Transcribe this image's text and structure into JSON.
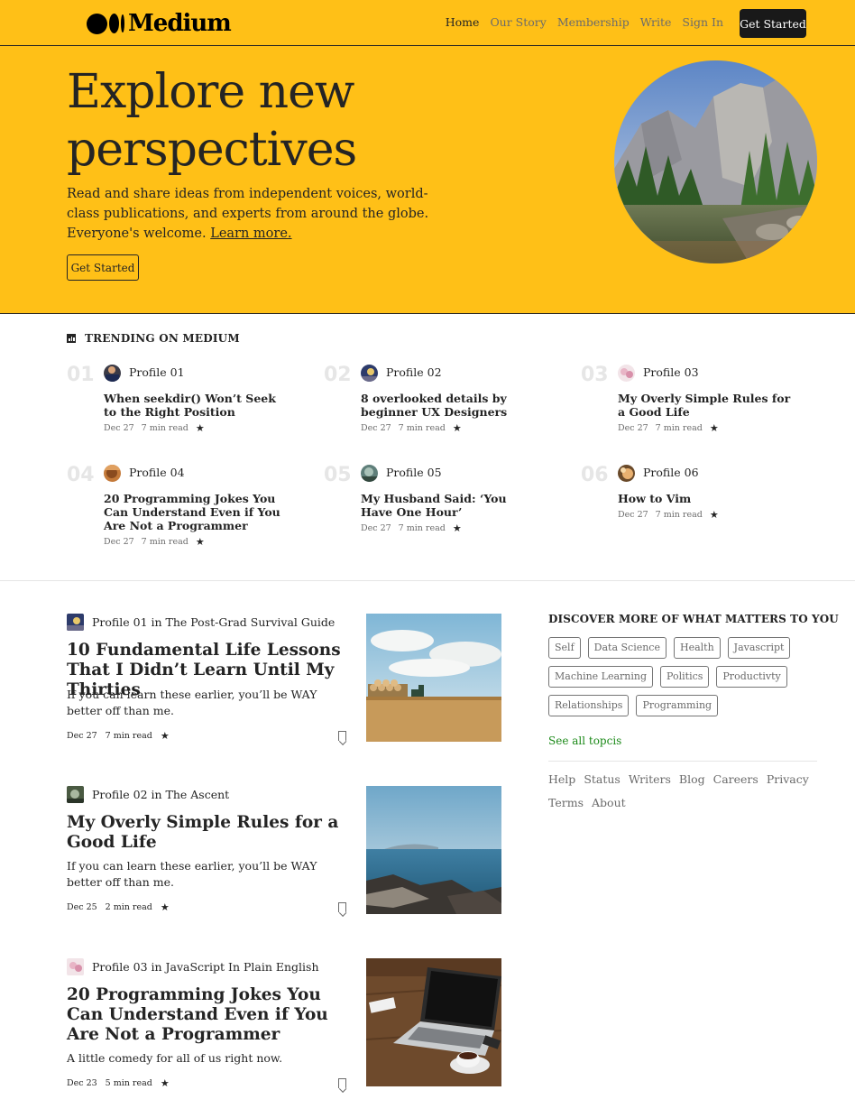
{
  "nav": {
    "brand": "Medium",
    "links": [
      "Home",
      "Our Story",
      "Membership",
      "Write",
      "Sign In"
    ],
    "cta": "Get Started"
  },
  "hero": {
    "title": "Explore new perspectives",
    "subtitle": "Read and share ideas from independent voices, world-class publications, and experts from around the globe. Everyone's welcome.",
    "learn_more": "Learn more.",
    "button": "Get Started"
  },
  "trending": {
    "heading": "TRENDING ON MEDIUM",
    "items": [
      {
        "num": "01",
        "author": "Profile 01",
        "title": "When seekdir() Won’t Seek to the Right Position",
        "date": "Dec 27",
        "read": "7 min read"
      },
      {
        "num": "02",
        "author": "Profile 02",
        "title": "8 overlooked details by beginner UX Designers",
        "date": "Dec 27",
        "read": "7 min read"
      },
      {
        "num": "03",
        "author": "Profile 03",
        "title": "My Overly Simple Rules for a Good Life",
        "date": "Dec 27",
        "read": "7 min read"
      },
      {
        "num": "04",
        "author": "Profile 04",
        "title": "20 Programming Jokes You Can Understand Even if You Are Not a Programmer",
        "date": "Dec 27",
        "read": "7 min read"
      },
      {
        "num": "05",
        "author": "Profile 05",
        "title": "My Husband Said: ‘You Have One Hour’",
        "date": "Dec 27",
        "read": "7 min read"
      },
      {
        "num": "06",
        "author": "Profile 06",
        "title": "How to Vim",
        "date": "Dec 27",
        "read": "7 min read"
      }
    ]
  },
  "feed": [
    {
      "byline": "Profile 01 in The Post-Grad Survival Guide",
      "title": "10 Fundamental Life Lessons That I Didn’t Learn Until My Thirties",
      "excerpt": "If you can learn these earlier, you’ll be WAY better off than me.",
      "date": "Dec 27",
      "read": "7 min read"
    },
    {
      "byline": "Profile 02 in The Ascent",
      "title": "My Overly Simple Rules for a Good Life",
      "excerpt": "If you can learn these earlier, you’ll be WAY better off than me.",
      "date": "Dec 25",
      "read": "2 min read"
    },
    {
      "byline": "Profile 03 in JavaScript In Plain English",
      "title": "20 Programming Jokes You Can Understand Even if You Are Not a Programmer",
      "excerpt": "A little comedy for all of us right now.",
      "date": "Dec 23",
      "read": "5 min read"
    }
  ],
  "sidebar": {
    "heading": "DISCOVER MORE OF WHAT MATTERS TO YOU",
    "tags": [
      "Self",
      "Data Science",
      "Health",
      "Javascript",
      "Machine Learning",
      "Politics",
      "Productivty",
      "Relationships",
      "Programming"
    ],
    "see_all": "See all topcis",
    "footer": [
      "Help",
      "Status",
      "Writers",
      "Blog",
      "Careers",
      "Privacy",
      "Terms",
      "About"
    ]
  },
  "colors": {
    "brand_yellow": "#ffc017",
    "text": "#242424",
    "muted": "#6b6b6b",
    "accent_green": "#1a8917"
  },
  "icons": {
    "trending": "trending-chart-icon",
    "star": "star-icon",
    "bookmark": "bookmark-icon"
  }
}
